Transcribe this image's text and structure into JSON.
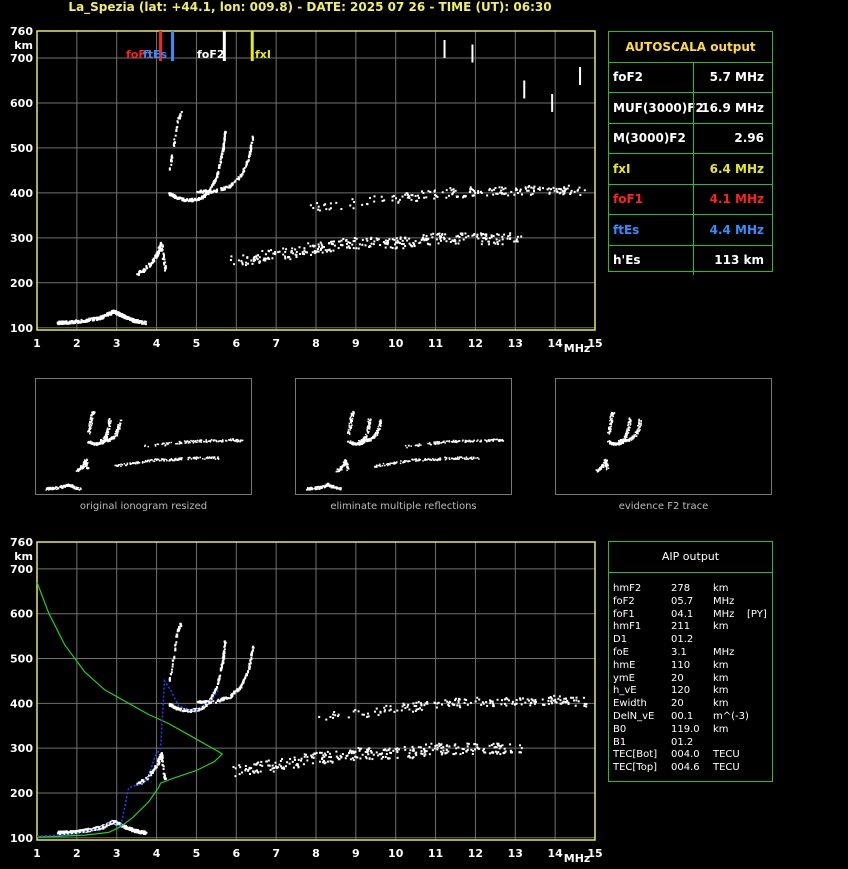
{
  "header": {
    "title": "La_Spezia (lat: +44.1, lon: 009.8) - DATE: 2025 07 26 - TIME (UT): 06:30"
  },
  "colors": {
    "grid": "#707070",
    "axis": "#e8e860",
    "panel_border": "#22c022",
    "foF2": "#ffffff",
    "foF1": "#ff2020",
    "ftEs": "#3090ff",
    "fxI": "#e8e820",
    "profile": "#20d020",
    "fit": "#2040ff"
  },
  "autoscala": {
    "title": "AUTOSCALA output",
    "rows": [
      {
        "label": "foF2",
        "value": "5.7 MHz",
        "color": "#ffffff"
      },
      {
        "label": "MUF(3000)F2",
        "value": "16.9 MHz",
        "color": "#ffffff"
      },
      {
        "label": "M(3000)F2",
        "value": "2.96",
        "color": "#ffffff"
      },
      {
        "label": "fxI",
        "value": "6.4 MHz",
        "color": "#e8e820"
      },
      {
        "label": "foF1",
        "value": "4.1 MHz",
        "color": "#ff2020"
      },
      {
        "label": "ftEs",
        "value": "4.4 MHz",
        "color": "#3090ff"
      },
      {
        "label": "h'Es",
        "value": "113 km",
        "color": "#ffffff"
      }
    ]
  },
  "aip": {
    "title": "AIP output",
    "rows": [
      {
        "name": "hmF2",
        "value": "278",
        "unit": "km",
        "extra": ""
      },
      {
        "name": "foF2",
        "value": "05.7",
        "unit": "MHz",
        "extra": ""
      },
      {
        "name": "foF1",
        "value": "04.1",
        "unit": "MHz",
        "extra": "[PY]"
      },
      {
        "name": "hmF1",
        "value": "211",
        "unit": "km",
        "extra": ""
      },
      {
        "name": "D1",
        "value": "01.2",
        "unit": "",
        "extra": ""
      },
      {
        "name": "foE",
        "value": "3.1",
        "unit": "MHz",
        "extra": ""
      },
      {
        "name": "hmE",
        "value": "110",
        "unit": "km",
        "extra": ""
      },
      {
        "name": "ymE",
        "value": "20",
        "unit": "km",
        "extra": ""
      },
      {
        "name": "h_vE",
        "value": "120",
        "unit": "km",
        "extra": ""
      },
      {
        "name": "Ewidth",
        "value": "20",
        "unit": "km",
        "extra": ""
      },
      {
        "name": "DelN_vE",
        "value": "00.1",
        "unit": "m^(-3)",
        "extra": ""
      },
      {
        "name": "B0",
        "value": "119.0",
        "unit": "km",
        "extra": ""
      },
      {
        "name": "B1",
        "value": "01.2",
        "unit": "",
        "extra": ""
      },
      {
        "name": "TEC[Bot]",
        "value": "004.0",
        "unit": "TECU",
        "extra": ""
      },
      {
        "name": "TEC[Top]",
        "value": "004.6",
        "unit": "TECU",
        "extra": ""
      }
    ]
  },
  "thumbnails": {
    "captions": [
      "original ionogram resized",
      "eliminate multiple reflections",
      "evidence F2 trace"
    ]
  },
  "chart_data": [
    {
      "type": "scatter",
      "title": "",
      "xlabel": "MHz",
      "ylabel": "km",
      "xlim": [
        1,
        15
      ],
      "ylim": [
        95,
        760
      ],
      "xticks": [
        1,
        2,
        3,
        4,
        5,
        6,
        7,
        8,
        9,
        10,
        11,
        12,
        13,
        14,
        15
      ],
      "yticks": [
        100,
        200,
        300,
        400,
        500,
        600,
        700,
        760
      ],
      "grid": true,
      "markers": [
        {
          "name": "foF1",
          "freq": 4.1,
          "color": "#ff2020"
        },
        {
          "name": "ftEs",
          "freq": 4.4,
          "color": "#3090ff"
        },
        {
          "name": "foF2",
          "freq": 5.7,
          "color": "#ffffff"
        },
        {
          "name": "fxI",
          "freq": 6.4,
          "color": "#e8e820"
        }
      ],
      "traces": {
        "Es": [
          [
            1.5,
            113
          ],
          [
            1.8,
            114
          ],
          [
            2.2,
            118
          ],
          [
            2.6,
            125
          ],
          [
            2.9,
            138
          ],
          [
            3.1,
            130
          ],
          [
            3.4,
            118
          ],
          [
            3.7,
            113
          ]
        ],
        "F1": [
          [
            3.5,
            220
          ],
          [
            3.8,
            240
          ],
          [
            4.0,
            265
          ],
          [
            4.1,
            290
          ],
          [
            4.2,
            230
          ]
        ],
        "F2_o": [
          [
            4.3,
            400
          ],
          [
            4.5,
            390
          ],
          [
            4.8,
            385
          ],
          [
            5.1,
            390
          ],
          [
            5.3,
            405
          ],
          [
            5.5,
            440
          ],
          [
            5.65,
            500
          ],
          [
            5.7,
            540
          ]
        ],
        "F2_x": [
          [
            5.0,
            405
          ],
          [
            5.4,
            405
          ],
          [
            5.8,
            415
          ],
          [
            6.1,
            440
          ],
          [
            6.3,
            480
          ],
          [
            6.4,
            530
          ]
        ],
        "F2_cusp": [
          [
            4.3,
            450
          ],
          [
            4.4,
            500
          ],
          [
            4.5,
            560
          ],
          [
            4.6,
            580
          ]
        ],
        "multiple": [
          [
            6.0,
            250
          ],
          [
            7.0,
            265
          ],
          [
            8.0,
            280
          ],
          [
            9.0,
            290
          ],
          [
            10.0,
            290
          ],
          [
            11.0,
            300
          ],
          [
            12.0,
            300
          ],
          [
            13.0,
            300
          ]
        ],
        "noise_400": [
          [
            8.0,
            370
          ],
          [
            10.0,
            390
          ],
          [
            11.0,
            400
          ],
          [
            12.0,
            405
          ],
          [
            13.0,
            405
          ],
          [
            14.0,
            410
          ],
          [
            14.6,
            405
          ]
        ]
      }
    },
    {
      "type": "line",
      "title": "",
      "xlabel": "MHz",
      "ylabel": "km",
      "xlim": [
        1,
        15
      ],
      "ylim": [
        95,
        760
      ],
      "xticks": [
        1,
        2,
        3,
        4,
        5,
        6,
        7,
        8,
        9,
        10,
        11,
        12,
        13,
        14,
        15
      ],
      "yticks": [
        100,
        200,
        300,
        400,
        500,
        600,
        700,
        760
      ],
      "grid": true,
      "series": [
        {
          "name": "",
          "color": "#20d020",
          "points": [
            [
              1.0,
              670
            ],
            [
              1.3,
              600
            ],
            [
              1.7,
              530
            ],
            [
              2.2,
              470
            ],
            [
              2.7,
              430
            ],
            [
              3.3,
              400
            ],
            [
              3.8,
              375
            ],
            [
              4.3,
              355
            ],
            [
              4.8,
              330
            ],
            [
              5.2,
              310
            ],
            [
              5.5,
              295
            ],
            [
              5.65,
              287
            ],
            [
              5.45,
              270
            ],
            [
              5.0,
              250
            ],
            [
              4.4,
              232
            ],
            [
              4.1,
              222
            ],
            [
              4.05,
              212
            ],
            [
              3.8,
              180
            ],
            [
              3.4,
              145
            ],
            [
              3.1,
              125
            ],
            [
              2.8,
              112
            ],
            [
              2.2,
              106
            ],
            [
              1.5,
              103
            ],
            [
              1.0,
              102
            ]
          ]
        },
        {
          "name": "",
          "color": "#2040ff",
          "points": [
            [
              1.0,
              103
            ],
            [
              1.5,
              106
            ],
            [
              2.0,
              110
            ],
            [
              2.5,
              120
            ],
            [
              2.9,
              135
            ],
            [
              3.1,
              125
            ],
            [
              3.3,
              212
            ],
            [
              3.6,
              220
            ],
            [
              3.8,
              235
            ],
            [
              3.95,
              280
            ],
            [
              4.1,
              300
            ],
            [
              4.2,
              450
            ],
            [
              4.35,
              430
            ],
            [
              4.55,
              395
            ],
            [
              4.8,
              385
            ],
            [
              5.0,
              385
            ],
            [
              5.2,
              395
            ],
            [
              5.4,
              410
            ],
            [
              5.55,
              430
            ]
          ]
        }
      ]
    }
  ]
}
